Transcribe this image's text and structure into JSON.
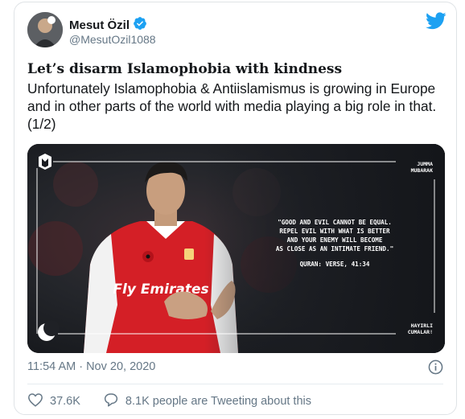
{
  "tweet": {
    "author_name": "Mesut Özil",
    "handle": "@MesutOzil1088",
    "headline": "Let’s disarm Islamophobia with kindness",
    "body": "Unfortunately Islamophobia & Antiislamismus is growing in Europe and in other parts of the world with media playing a big role in that. (1/2)",
    "timestamp": "11:54 AM · Nov 20, 2020",
    "likes": "37.6K",
    "comment_summary": "8.1K people are Tweeting about this"
  },
  "media": {
    "badge_top": "JUMMA",
    "badge_bottom": "MUBARAK",
    "quote_lines": [
      "\"GOOD AND EVIL CANNOT BE EQUAL.",
      "REPEL EVIL WITH WHAT IS BETTER",
      "AND YOUR ENEMY WILL BECOME",
      "AS CLOSE AS AN INTIMATE FRIEND.\""
    ],
    "source": "QURAN: VERSE, 41:34",
    "footer_top": "HAYIRLI",
    "footer_bottom": "CUMALAR!",
    "shirt_text": "Fly Emirates"
  },
  "colors": {
    "twitter_blue": "#1da1f2",
    "secondary_text": "#657786",
    "arsenal_red": "#d41f26"
  },
  "icons": [
    "verified-badge-icon",
    "twitter-bird-icon",
    "info-icon",
    "heart-icon",
    "comment-icon",
    "crescent-moon-icon",
    "player-logo-icon"
  ]
}
